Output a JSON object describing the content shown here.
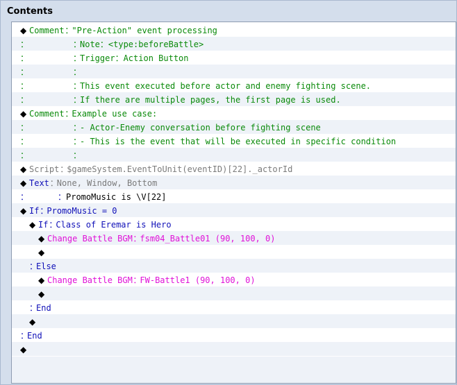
{
  "panel": {
    "title": "Contents"
  },
  "rows": [
    {
      "indent": 0,
      "parts": [
        {
          "t": "◆",
          "c": "black"
        },
        {
          "t": "Comment",
          "c": "green"
        },
        {
          "t": "：",
          "c": "green"
        },
        {
          "t": "\"Pre-Action\" event processing",
          "c": "green"
        }
      ]
    },
    {
      "indent": 0,
      "parts": [
        {
          "t": "：",
          "c": "green"
        },
        {
          "t": "",
          "c": "green"
        },
        {
          "t": "：",
          "c": "green"
        },
        {
          "t": "Note：<type:beforeBattle>",
          "c": "green"
        }
      ]
    },
    {
      "indent": 0,
      "parts": [
        {
          "t": "：",
          "c": "green"
        },
        {
          "t": "",
          "c": "green"
        },
        {
          "t": "：",
          "c": "green"
        },
        {
          "t": "Trigger：Action Button",
          "c": "green"
        }
      ]
    },
    {
      "indent": 0,
      "parts": [
        {
          "t": "：",
          "c": "green"
        },
        {
          "t": "",
          "c": "green"
        },
        {
          "t": "：",
          "c": "green"
        },
        {
          "t": "",
          "c": "green"
        }
      ]
    },
    {
      "indent": 0,
      "parts": [
        {
          "t": "：",
          "c": "green"
        },
        {
          "t": "",
          "c": "green"
        },
        {
          "t": "：",
          "c": "green"
        },
        {
          "t": "This event executed before actor and enemy fighting scene.",
          "c": "green"
        }
      ]
    },
    {
      "indent": 0,
      "parts": [
        {
          "t": "：",
          "c": "green"
        },
        {
          "t": "",
          "c": "green"
        },
        {
          "t": "：",
          "c": "green"
        },
        {
          "t": "If there are multiple pages, the first page is used.",
          "c": "green"
        }
      ]
    },
    {
      "indent": 0,
      "parts": [
        {
          "t": "◆",
          "c": "black"
        },
        {
          "t": "Comment",
          "c": "green"
        },
        {
          "t": "：",
          "c": "green"
        },
        {
          "t": "Example use case:",
          "c": "green"
        }
      ]
    },
    {
      "indent": 0,
      "parts": [
        {
          "t": "：",
          "c": "green"
        },
        {
          "t": "",
          "c": "green"
        },
        {
          "t": "：",
          "c": "green"
        },
        {
          "t": "- Actor-Enemy conversation before fighting scene",
          "c": "green"
        }
      ]
    },
    {
      "indent": 0,
      "parts": [
        {
          "t": "：",
          "c": "green"
        },
        {
          "t": "",
          "c": "green"
        },
        {
          "t": "：",
          "c": "green"
        },
        {
          "t": "- This is the event that will be executed in specific condition",
          "c": "green"
        }
      ]
    },
    {
      "indent": 0,
      "parts": [
        {
          "t": "：",
          "c": "green"
        },
        {
          "t": "",
          "c": "green"
        },
        {
          "t": "：",
          "c": "green"
        },
        {
          "t": "",
          "c": "green"
        }
      ]
    },
    {
      "indent": 0,
      "parts": [
        {
          "t": "◆",
          "c": "black"
        },
        {
          "t": "Script",
          "c": "gray"
        },
        {
          "t": "：",
          "c": "gray"
        },
        {
          "t": "$gameSystem.EventToUnit(eventID)[22]._actorId",
          "c": "gray"
        }
      ]
    },
    {
      "indent": 0,
      "parts": [
        {
          "t": "◆",
          "c": "black"
        },
        {
          "t": "Text",
          "c": "blue"
        },
        {
          "t": "：",
          "c": "gray"
        },
        {
          "t": "None, Window, Bottom",
          "c": "gray"
        }
      ]
    },
    {
      "indent": 0,
      "parts": [
        {
          "t": "：",
          "c": "blue"
        },
        {
          "t": "",
          "c": "blue"
        },
        {
          "t": "：",
          "c": "blue"
        },
        {
          "t": "PromoMusic is \\V[22]",
          "c": "black"
        }
      ]
    },
    {
      "indent": 0,
      "parts": [
        {
          "t": "◆",
          "c": "black"
        },
        {
          "t": "If",
          "c": "blue"
        },
        {
          "t": "：",
          "c": "blue"
        },
        {
          "t": "PromoMusic = 0",
          "c": "blue"
        }
      ]
    },
    {
      "indent": 1,
      "parts": [
        {
          "t": "◆",
          "c": "black"
        },
        {
          "t": "If",
          "c": "blue"
        },
        {
          "t": "：",
          "c": "blue"
        },
        {
          "t": "Class of Eremar is Hero",
          "c": "blue"
        }
      ]
    },
    {
      "indent": 2,
      "parts": [
        {
          "t": "◆",
          "c": "black"
        },
        {
          "t": "Change Battle BGM",
          "c": "pink"
        },
        {
          "t": "：",
          "c": "pink"
        },
        {
          "t": "fsm04_Battle01 (90, 100, 0)",
          "c": "pink"
        }
      ]
    },
    {
      "indent": 2,
      "parts": [
        {
          "t": "◆",
          "c": "black"
        }
      ]
    },
    {
      "indent": 1,
      "parts": [
        {
          "t": "：",
          "c": "blue"
        },
        {
          "t": "Else",
          "c": "blue"
        }
      ]
    },
    {
      "indent": 2,
      "parts": [
        {
          "t": "◆",
          "c": "black"
        },
        {
          "t": "Change Battle BGM",
          "c": "pink"
        },
        {
          "t": "：",
          "c": "pink"
        },
        {
          "t": "FW-Battle1 (90, 100, 0)",
          "c": "pink"
        }
      ]
    },
    {
      "indent": 2,
      "parts": [
        {
          "t": "◆",
          "c": "black"
        }
      ]
    },
    {
      "indent": 1,
      "parts": [
        {
          "t": "：",
          "c": "blue"
        },
        {
          "t": "End",
          "c": "blue"
        }
      ]
    },
    {
      "indent": 1,
      "parts": [
        {
          "t": "◆",
          "c": "black"
        }
      ]
    },
    {
      "indent": 0,
      "parts": [
        {
          "t": "：",
          "c": "blue"
        },
        {
          "t": "End",
          "c": "blue"
        }
      ]
    },
    {
      "indent": 0,
      "parts": [
        {
          "t": "◆",
          "c": "black"
        }
      ]
    }
  ]
}
